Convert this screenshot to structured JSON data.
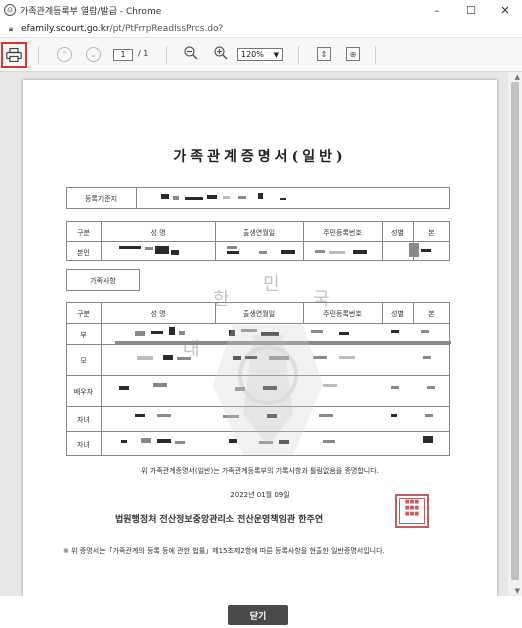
{
  "window": {
    "title": "가족관계등록부 열람/발급 - Chrome",
    "url_domain": "efamily.scourt.go.kr",
    "url_path": "/pt/PtFrrpReadIssPrcs.do?",
    "minimize": "–",
    "maximize": "☐",
    "close": "✕"
  },
  "toolbar": {
    "page_current": "1",
    "page_total": "/ 1",
    "zoom": "120%"
  },
  "document": {
    "title": "가족관계증명서(일반)",
    "reg_base_label": "등록기준지",
    "table1_headers": [
      "구분",
      "성 명",
      "출생연월일",
      "주민등록번호",
      "성별",
      "본"
    ],
    "table1_row_label": "본인",
    "family_label": "가족사항",
    "table2_headers": [
      "구분",
      "성 명",
      "출생연월일",
      "주민등록번호",
      "성별",
      "본"
    ],
    "table2_rows": [
      "부",
      "모",
      "배우자",
      "자녀",
      "자녀"
    ],
    "certify_text": "위 가족관계증명서(일반)는 가족관계등록부의 기록사항과 틀림없음을 증명합니다.",
    "date": "2022년 01월 09일",
    "issuer": "법원행정처 전산정보중앙관리소 전산운영책임관 한주연",
    "footnote": "※ 위 증명서는「가족관계의 등록 등에 관한 법률」제15조제2항에 따른 등록사항을 현출한 일반증명서입니다.",
    "watermark": [
      "대",
      "한",
      "민",
      "국"
    ]
  },
  "bottom": {
    "close_label": "닫기"
  },
  "colors": {
    "highlight": "#e53030",
    "close_button": "#4a4a4a",
    "seal": "#b94040"
  }
}
